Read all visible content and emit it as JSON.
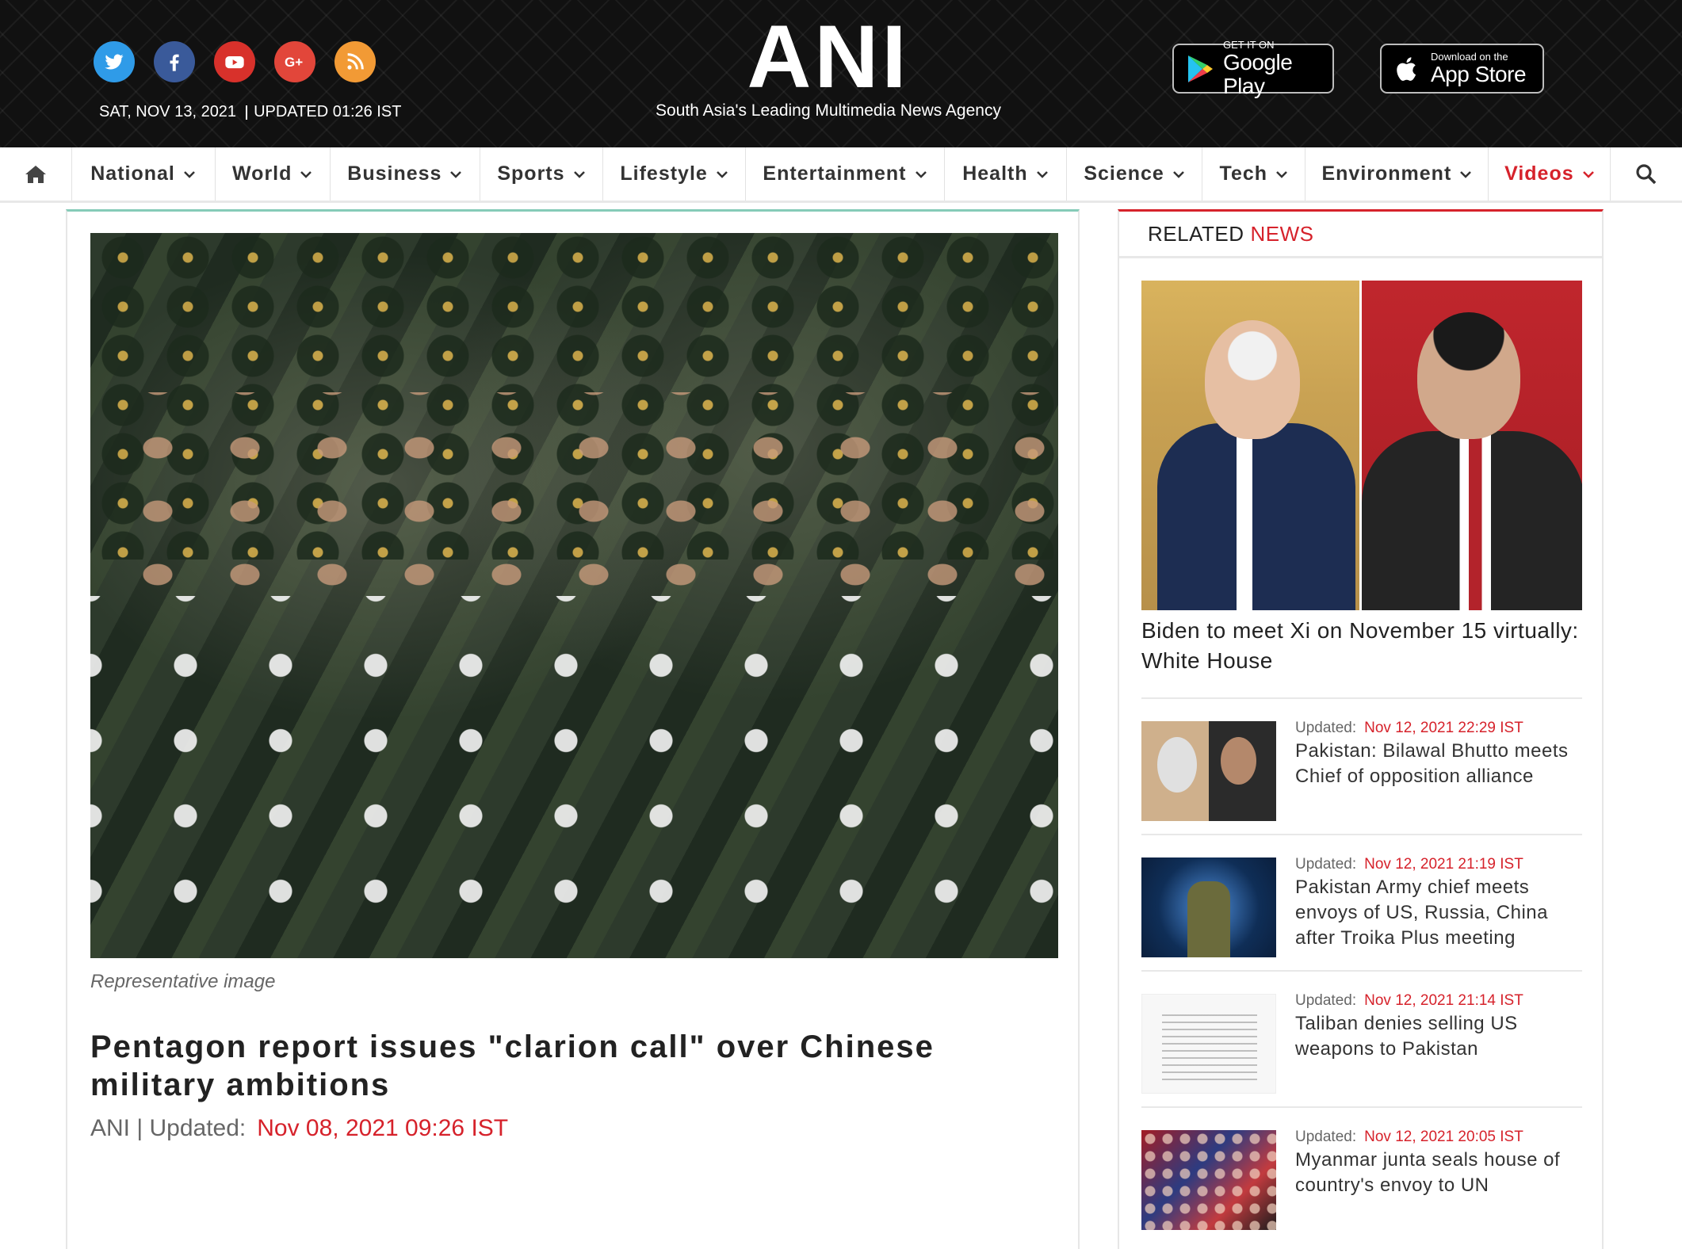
{
  "header": {
    "social_icons": [
      "twitter-icon",
      "facebook-icon",
      "youtube-icon",
      "google-plus-icon",
      "rss-icon"
    ],
    "date": "SAT, NOV 13, 2021",
    "updated": "UPDATED 01:26 IST",
    "logo": "ANI",
    "tagline": "South Asia's Leading Multimedia News Agency",
    "google_play": {
      "small": "GET IT ON",
      "name": "Google Play"
    },
    "app_store": {
      "small": "Download on the",
      "name": "App Store"
    }
  },
  "nav": {
    "items": [
      {
        "label": "National"
      },
      {
        "label": "World"
      },
      {
        "label": "Business"
      },
      {
        "label": "Sports"
      },
      {
        "label": "Lifestyle"
      },
      {
        "label": "Entertainment"
      },
      {
        "label": "Health"
      },
      {
        "label": "Science"
      },
      {
        "label": "Tech"
      },
      {
        "label": "Environment"
      },
      {
        "label": "Videos"
      }
    ],
    "highlight_color": "#d6222b"
  },
  "article": {
    "caption": "Representative image",
    "title": "Pentagon report issues \"clarion call\" over Chinese military ambitions",
    "source": "ANI | Updated:",
    "date": "Nov 08, 2021 09:26 IST"
  },
  "sidebar": {
    "heading_a": "RELATED",
    "heading_b": "NEWS",
    "feature_title": "Biden to meet Xi on November 15 virtually: White House",
    "items": [
      {
        "updated_label": "Updated:",
        "date": "Nov 12, 2021 22:29 IST",
        "title": "Pakistan: Bilawal Bhutto meets Chief of opposition alliance"
      },
      {
        "updated_label": "Updated:",
        "date": "Nov 12, 2021 21:19 IST",
        "title": "Pakistan Army chief meets envoys of US, Russia, China after Troika Plus meeting"
      },
      {
        "updated_label": "Updated:",
        "date": "Nov 12, 2021 21:14 IST",
        "title": "Taliban denies selling US weapons to Pakistan"
      },
      {
        "updated_label": "Updated:",
        "date": "Nov 12, 2021 20:05 IST",
        "title": "Myanmar junta seals house of country's envoy to UN"
      }
    ]
  },
  "colors": {
    "accent": "#d6222b",
    "header_bg": "#111111",
    "article_border": "#86cbb8"
  }
}
